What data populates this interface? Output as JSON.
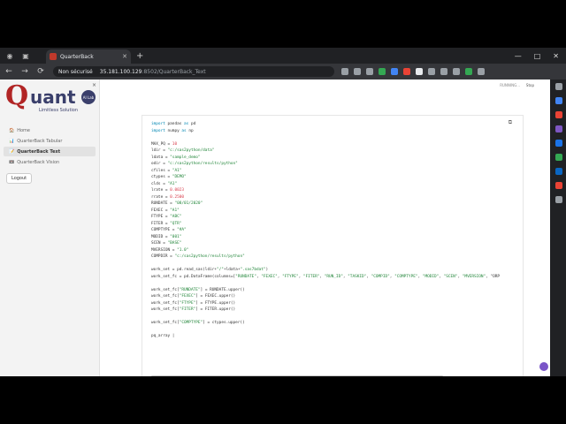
{
  "browser": {
    "tab_title": "QuarterBack",
    "tab_close": "✕",
    "new_tab": "+",
    "security_label": "Non sécurisé",
    "url_host": "35.181.100.129",
    "url_path": ":8502/QuarterBack_Text",
    "back": "←",
    "forward": "→",
    "reload": "⟳",
    "minimize": "—",
    "maximize": "□",
    "close": "✕"
  },
  "app": {
    "logo_q": "Q",
    "logo_rest": "uant",
    "logo_badge": "AI Lab",
    "logo_tagline": "Limitless Solution",
    "sidebar_close": "×",
    "nav": [
      {
        "icon": "🏠",
        "label": "Home"
      },
      {
        "icon": "📊",
        "label": "QuarterBack Tabular"
      },
      {
        "icon": "📝",
        "label": "QuarterBack Text"
      },
      {
        "icon": "📼",
        "label": "QuarterBack Vision"
      }
    ],
    "logout_label": "Logout",
    "running_label": "RUNNING...",
    "stop_label": "Stop"
  },
  "code": {
    "lines": [
      "import pandas as pd",
      "import numpy as np",
      "",
      "MAX_PQ = 10",
      "ldir = \"c:/sas2python/data\"",
      "ldata = \"sample_demo\"",
      "odir = \"c:/sas2python/results/python\"",
      "cfiles = \"A1\"",
      "ctypes = \"DEMO\"",
      "clds = \"A1\"",
      "lrate = 0.0023",
      "rrate = 0.2500",
      "RUNDATE = \"08/01/2020\"",
      "FEXEC = \"A1\"",
      "FTYPE = \"ABC\"",
      "FITER = \"QTR\"",
      "COMPTYPE = \"#A\"",
      "MODID = \"001\"",
      "SCEN = \"BASE\"",
      "MVERSION = \"1.0\"",
      "COMPDIR = \"c:/sas2python/results/python\"",
      "",
      "work_set = pd.read_sas(ldir+\"/\"+ldata+\".sas7bdat\")",
      "work_set_fc = pd.DataFrame(columns=[\"RUNDATE\", \"FEXEC\", \"FTYPE\", \"FITER\", \"RUN_ID\", \"TASKID\", \"COMPID\", \"COMPTYPE\", \"MODID\", \"SCEN\", \"MVERSION\", \"ORP",
      "",
      "work_set_fc[\"RUNDATE\"] = RUNDATE.upper()",
      "work_set_fc[\"FEXEC\"] = FEXEC.upper()",
      "work_set_fc[\"FTYPE\"] = FTYPE.upper()",
      "work_set_fc[\"FITER\"] = FITER.upper()",
      "",
      "work_set_fc[\"COMPTYPE\"] = ctypes.upper()",
      "",
      "pq_array |"
    ],
    "copy_icon": "⧉"
  },
  "colors": {
    "brand_red": "#b12525",
    "brand_navy": "#3a3f6b"
  }
}
